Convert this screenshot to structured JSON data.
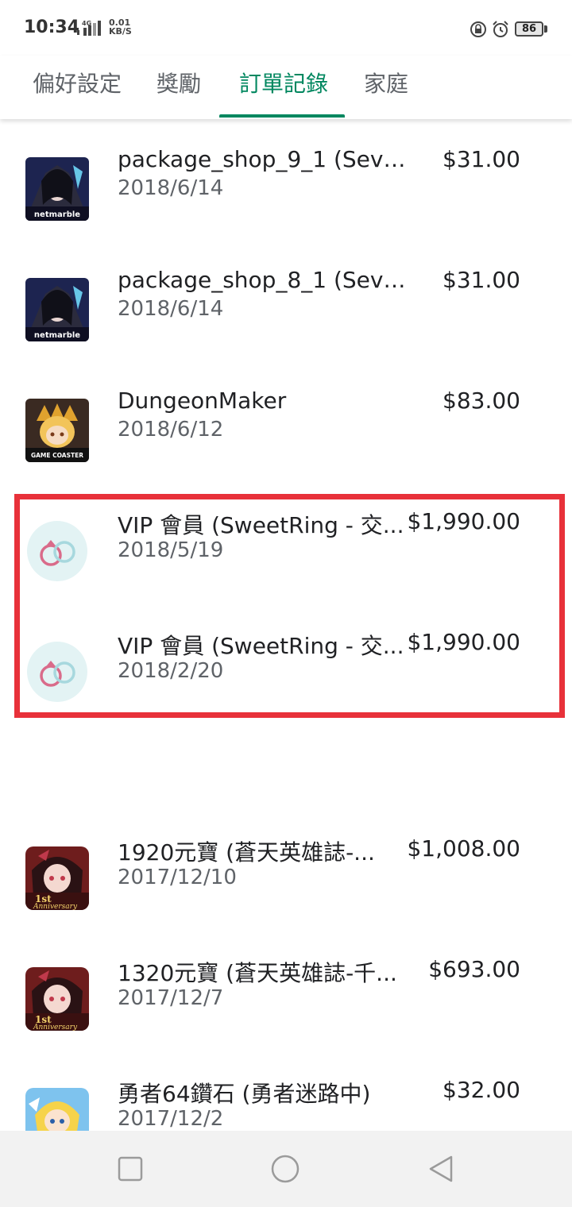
{
  "status_bar": {
    "time": "10:34",
    "network_label": "4G",
    "speed_value": "0.01",
    "speed_unit": "KB/S",
    "battery": "86"
  },
  "tabs": [
    {
      "label": "偏好設定",
      "active": false
    },
    {
      "label": "獎勵",
      "active": false
    },
    {
      "label": "訂單記錄",
      "active": true
    },
    {
      "label": "家庭",
      "active": false
    }
  ],
  "orders": [
    {
      "title": "package_shop_9_1 (Seven...",
      "date": "2018/6/14",
      "price": "$31.00",
      "icon": "seven-knights-netmarble-icon"
    },
    {
      "title": "package_shop_8_1 (Seven...",
      "date": "2018/6/14",
      "price": "$31.00",
      "icon": "seven-knights-netmarble-icon"
    },
    {
      "title": "DungeonMaker",
      "date": "2018/6/12",
      "price": "$83.00",
      "icon": "dungeon-maker-game-icon"
    },
    {
      "title": "VIP 會員 (SweetRing - 交...",
      "date": "2018/5/19",
      "price": "$1,990.00",
      "icon": "sweetring-rings-icon"
    },
    {
      "title": "VIP 會員 (SweetRing - 交...",
      "date": "2018/2/20",
      "price": "$1,990.00",
      "icon": "sweetring-rings-icon"
    },
    {
      "title": "1920元寶 (蒼天英雄誌-...",
      "date": "2017/12/10",
      "price": "$1,008.00",
      "icon": "heroes-anniversary-game-icon"
    },
    {
      "title": "1320元寶 (蒼天英雄誌-千...",
      "date": "2017/12/7",
      "price": "$693.00",
      "icon": "heroes-anniversary-game-icon"
    },
    {
      "title": "勇者64鑽石 (勇者迷路中)",
      "date": "2017/12/2",
      "price": "$32.00",
      "icon": "brave-lost-game-icon"
    }
  ],
  "icon_text": {
    "netmarble": "netmarble",
    "game_coaster": "GAME COASTER",
    "anniversary_top": "1st",
    "anniversary_bottom": "Anniversary"
  },
  "colors": {
    "accent": "#01875f",
    "highlight": "#e8313a"
  },
  "navbar": [
    "recent-apps-button",
    "home-button",
    "back-button"
  ]
}
